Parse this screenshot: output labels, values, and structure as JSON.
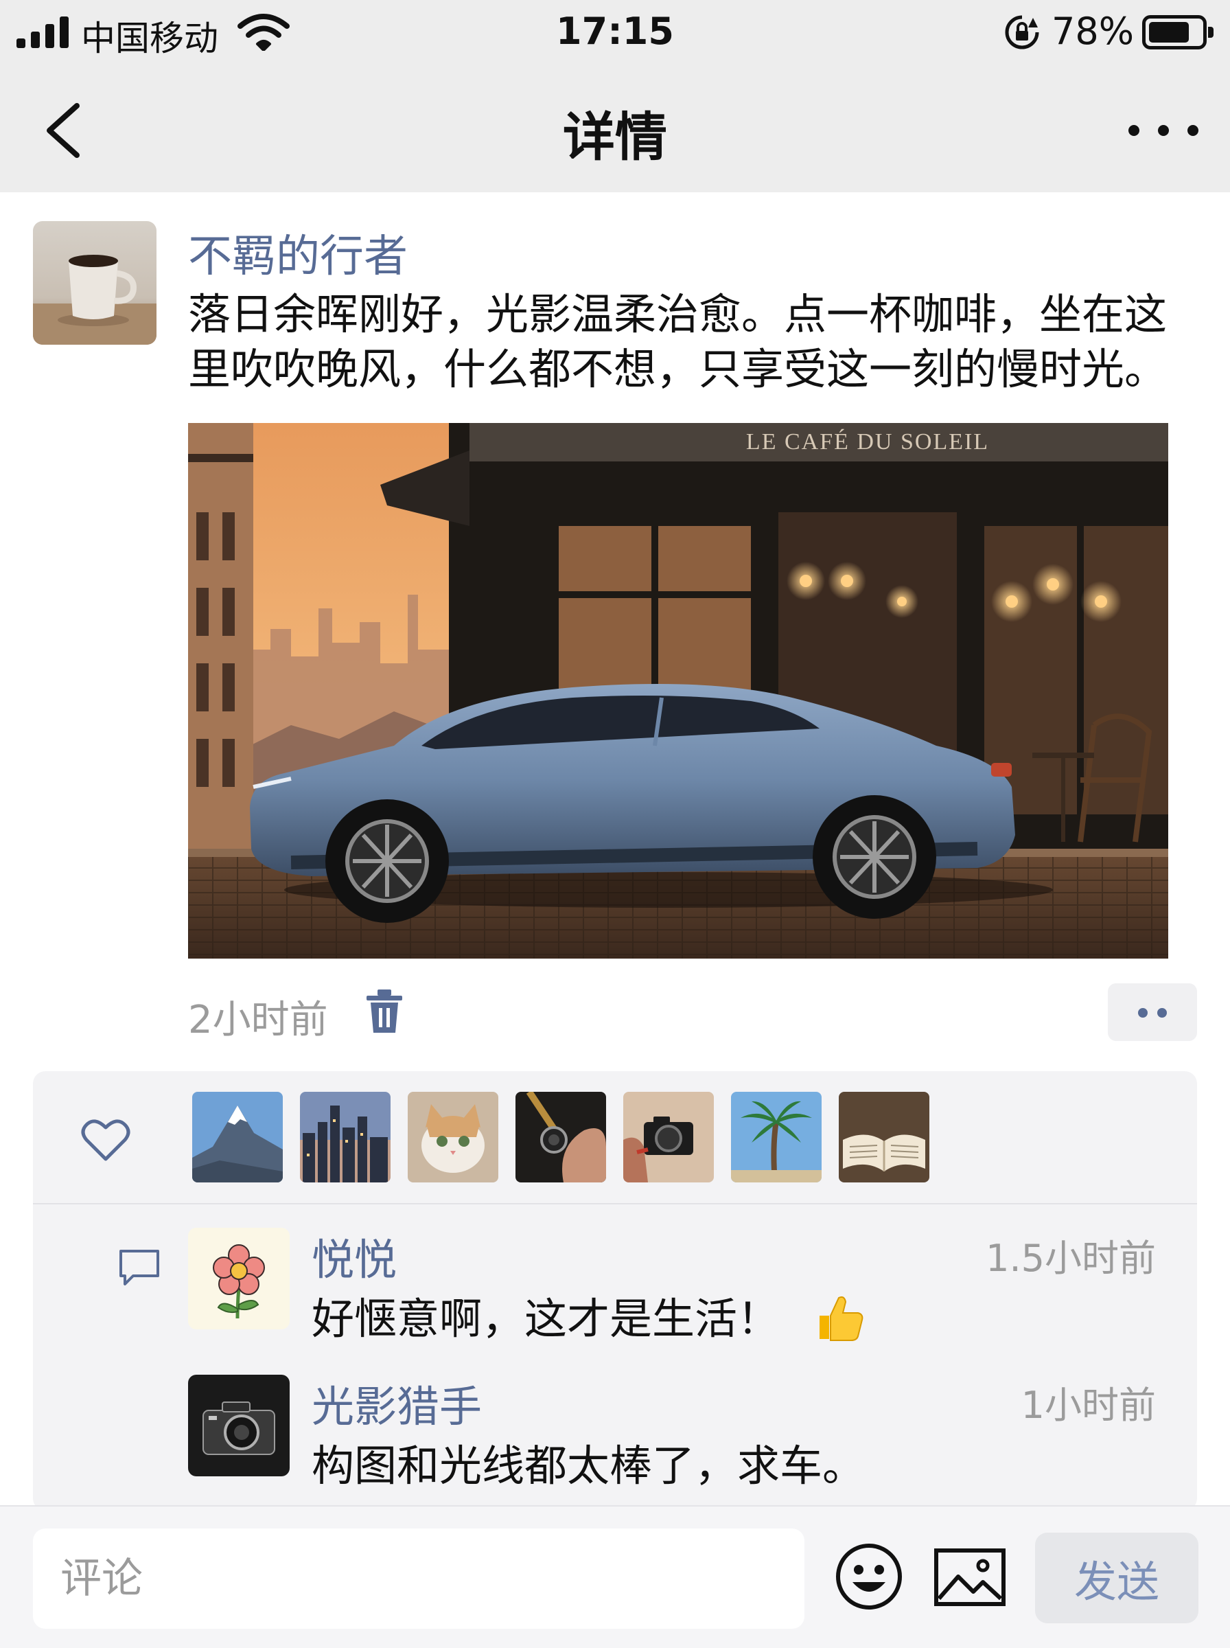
{
  "status_bar": {
    "carrier": "中国移动",
    "time": "17:15",
    "battery_percent_label": "78%",
    "battery_level": 0.78
  },
  "nav": {
    "title": "详情",
    "back_icon": "chevron-left-icon",
    "more_icon": "more-horizontal-icon"
  },
  "post": {
    "author": "不羁的行者",
    "avatar_icon": "coffee-cup-photo",
    "text": "落日余晖刚好，光影温柔治愈。点一杯咖啡，坐在这里吹吹晚风，什么都不想，只享受这一刻的慢时光。",
    "photo_sign": "LE CAFÉ DU SOLEIL",
    "time_ago": "2小时前",
    "delete_icon": "trash-icon",
    "more_icon": "two-dots-icon"
  },
  "likes": {
    "icon": "heart-icon",
    "avatars": [
      "mountain",
      "city-skyline",
      "cat",
      "lens-in-hand",
      "camera-in-hand",
      "palm-tree",
      "open-book"
    ]
  },
  "comments": [
    {
      "name": "悦悦",
      "time": "1.5小时前",
      "text": "好惬意啊，这才是生活！",
      "avatar": "flower-drawing",
      "emoji": "thumbs-up"
    },
    {
      "name": "光影猎手",
      "time": "1小时前",
      "text": "构图和光线都太棒了，求车。",
      "avatar": "camera-photo"
    }
  ],
  "input_bar": {
    "placeholder": "评论",
    "send_label": "发送",
    "emoji_icon": "smiley-icon",
    "image_icon": "image-icon"
  },
  "colors": {
    "link": "#576b95",
    "header_bg": "#ededed",
    "feedback_bg": "#f3f3f5",
    "muted_text": "#9b9b9b"
  }
}
